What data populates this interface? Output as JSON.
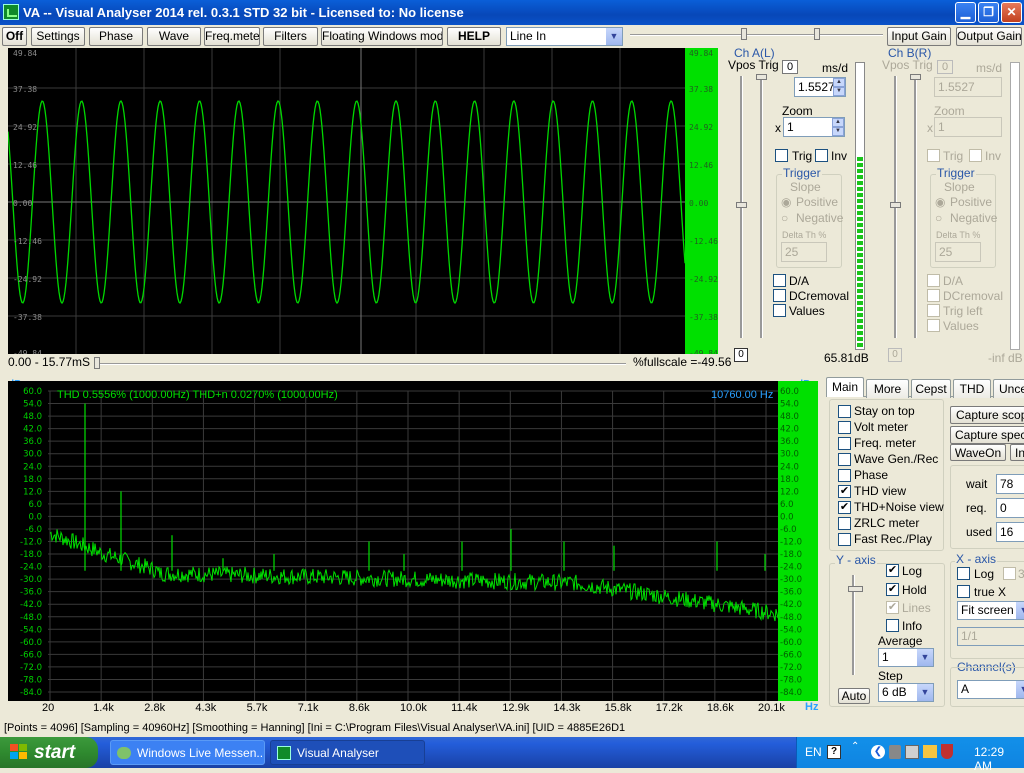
{
  "window": {
    "title": "VA -- Visual Analyser 2014 rel. 0.3.1 STD 32 bit - Licensed to: No license"
  },
  "toolbar": {
    "off": "Off",
    "settings": "Settings",
    "phase": "Phase",
    "wave": "Wave",
    "freqmeter": "Freq.meter",
    "filters": "Filters",
    "floating": "Floating Windows mode",
    "help": "HELP",
    "input_select": "Line In",
    "input_gain": "Input Gain",
    "output_gain": "Output Gain"
  },
  "scope": {
    "y_ticks": [
      "49.84",
      "37.38",
      "24.92",
      "12.46",
      "0.00",
      "-12.46",
      "-24.92",
      "-37.38",
      "-49.84"
    ],
    "time_range": "0.00 - 15.77mS",
    "fullscale": "%fullscale =-49.56"
  },
  "chA": {
    "title": "Ch A(L)",
    "vpos_trig": "Vpos Trig",
    "zero_btn": "0",
    "ms_div": "ms/d",
    "ms_value": "1.5527",
    "zoom_label": "Zoom",
    "zoom_x": "x",
    "zoom_value": "1",
    "trig": "Trig",
    "inv": "Inv",
    "trigger": "Trigger",
    "slope": "Slope",
    "positive": "Positive",
    "negative": "Negative",
    "delta": "Delta Th %",
    "delta_value": "25",
    "da": "D/A",
    "dcremoval": "DCremoval",
    "values": "Values",
    "bottom_zero": "0",
    "level": "65.81dB"
  },
  "chB": {
    "title": "Ch B(R)",
    "vpos_trig": "Vpos Trig",
    "zero_btn": "0",
    "ms_div": "ms/d",
    "ms_value": "1.5527",
    "zoom_label": "Zoom",
    "zoom_x": "x",
    "zoom_value": "1",
    "trig": "Trig",
    "inv": "Inv",
    "trigger": "Trigger",
    "slope": "Slope",
    "positive": "Positive",
    "negative": "Negative",
    "delta": "Delta Th %",
    "delta_value": "25",
    "da": "D/A",
    "dcremoval": "DCremoval",
    "trig_left": "Trig left",
    "values": "Values",
    "bottom_zero": "0",
    "level": "-inf dB"
  },
  "spectrum": {
    "unit_y": "dBr",
    "unit_x": "Hz",
    "thd_text": "THD  0.5556% (1000.00Hz) THD+n  0.0270% (1000.00Hz)",
    "cursor_freq": "10760.00 Hz",
    "y_ticks": [
      "60.0",
      "54.0",
      "48.0",
      "42.0",
      "36.0",
      "30.0",
      "24.0",
      "18.0",
      "12.0",
      "6.0",
      "0.0",
      "-6.0",
      "-12.0",
      "-18.0",
      "-24.0",
      "-30.0",
      "-36.0",
      "-42.0",
      "-48.0",
      "-54.0",
      "-60.0",
      "-66.0",
      "-72.0",
      "-78.0",
      "-84.0"
    ],
    "x_ticks": [
      "20",
      "1.4k",
      "2.8k",
      "4.3k",
      "5.7k",
      "7.1k",
      "8.6k",
      "10.0k",
      "11.4k",
      "12.9k",
      "14.3k",
      "15.8k",
      "17.2k",
      "18.6k",
      "20.1k"
    ]
  },
  "tabs": [
    "Main",
    "More",
    "Cepst",
    "THD",
    "Unce"
  ],
  "main_options": [
    {
      "label": "Stay on top",
      "checked": false
    },
    {
      "label": "Volt meter",
      "checked": false
    },
    {
      "label": "Freq. meter",
      "checked": false
    },
    {
      "label": "Wave Gen./Rec",
      "checked": false
    },
    {
      "label": "Phase",
      "checked": false
    },
    {
      "label": "THD view",
      "checked": true
    },
    {
      "label": "THD+Noise view",
      "checked": true
    },
    {
      "label": "ZRLC meter",
      "checked": false
    },
    {
      "label": "Fast Rec./Play",
      "checked": false
    }
  ],
  "capture": {
    "scope": "Capture scope",
    "spectrum": "Capture spectrum",
    "waveon": "WaveOn",
    "in": "In",
    "wait_label": "wait",
    "wait_value": "78",
    "req_label": "req.",
    "req_value": "0",
    "used_label": "used",
    "used_value": "16"
  },
  "yaxis": {
    "title": "Y - axis",
    "log": "Log",
    "hold": "Hold",
    "lines": "Lines",
    "info": "Info",
    "average_label": "Average",
    "average_value": "1",
    "step_label": "Step",
    "step_value": "6 dB",
    "auto": "Auto"
  },
  "xaxis": {
    "title": "X - axis",
    "log": "Log",
    "three": "3",
    "true_x": "true X",
    "fit": "Fit screen",
    "ratio": "1/1"
  },
  "channels": {
    "label": "Channel(s)",
    "value": "A"
  },
  "status": "[Points = 4096]  [Sampling = 40960Hz]  [Smoothing = Hanning]  [Ini = C:\\Program Files\\Visual Analyser\\VA.ini]  [UID = 4885E26D1",
  "taskbar": {
    "start": "start",
    "items": [
      "Windows Live Messen...",
      "Visual Analyser"
    ],
    "lang": "EN",
    "time": "12:29 AM"
  },
  "colors": {
    "trace": "#00e000",
    "title_blue": "#0747b8",
    "axis_cyan": "#29a0ff"
  }
}
